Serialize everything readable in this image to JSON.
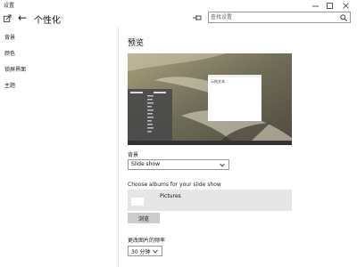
{
  "window": {
    "app_title": "设置",
    "controls": {
      "minimize": "—",
      "maximize": "☐",
      "close": "✕"
    }
  },
  "header": {
    "back_glyph": "←",
    "page_title": "个性化",
    "search_placeholder": "查找设置"
  },
  "sidebar": {
    "items": [
      {
        "label": "背景"
      },
      {
        "label": "颜色"
      },
      {
        "label": "锁屏界面"
      },
      {
        "label": "主题"
      }
    ]
  },
  "main": {
    "preview": {
      "title": "预览",
      "sample_text": "示例文本"
    },
    "background": {
      "label": "背景",
      "selected": "Slide show"
    },
    "albums": {
      "label": "Choose albums for your slide show",
      "items": [
        {
          "name": "Pictures"
        }
      ],
      "browse_label": "浏览"
    },
    "interval": {
      "label": "更改图片的频率",
      "selected": "30 分钟"
    }
  },
  "colors": {
    "accent": "#7d7a66",
    "album_box_bg": "#e6e6e6",
    "browse_button_bg": "#cccccc"
  }
}
